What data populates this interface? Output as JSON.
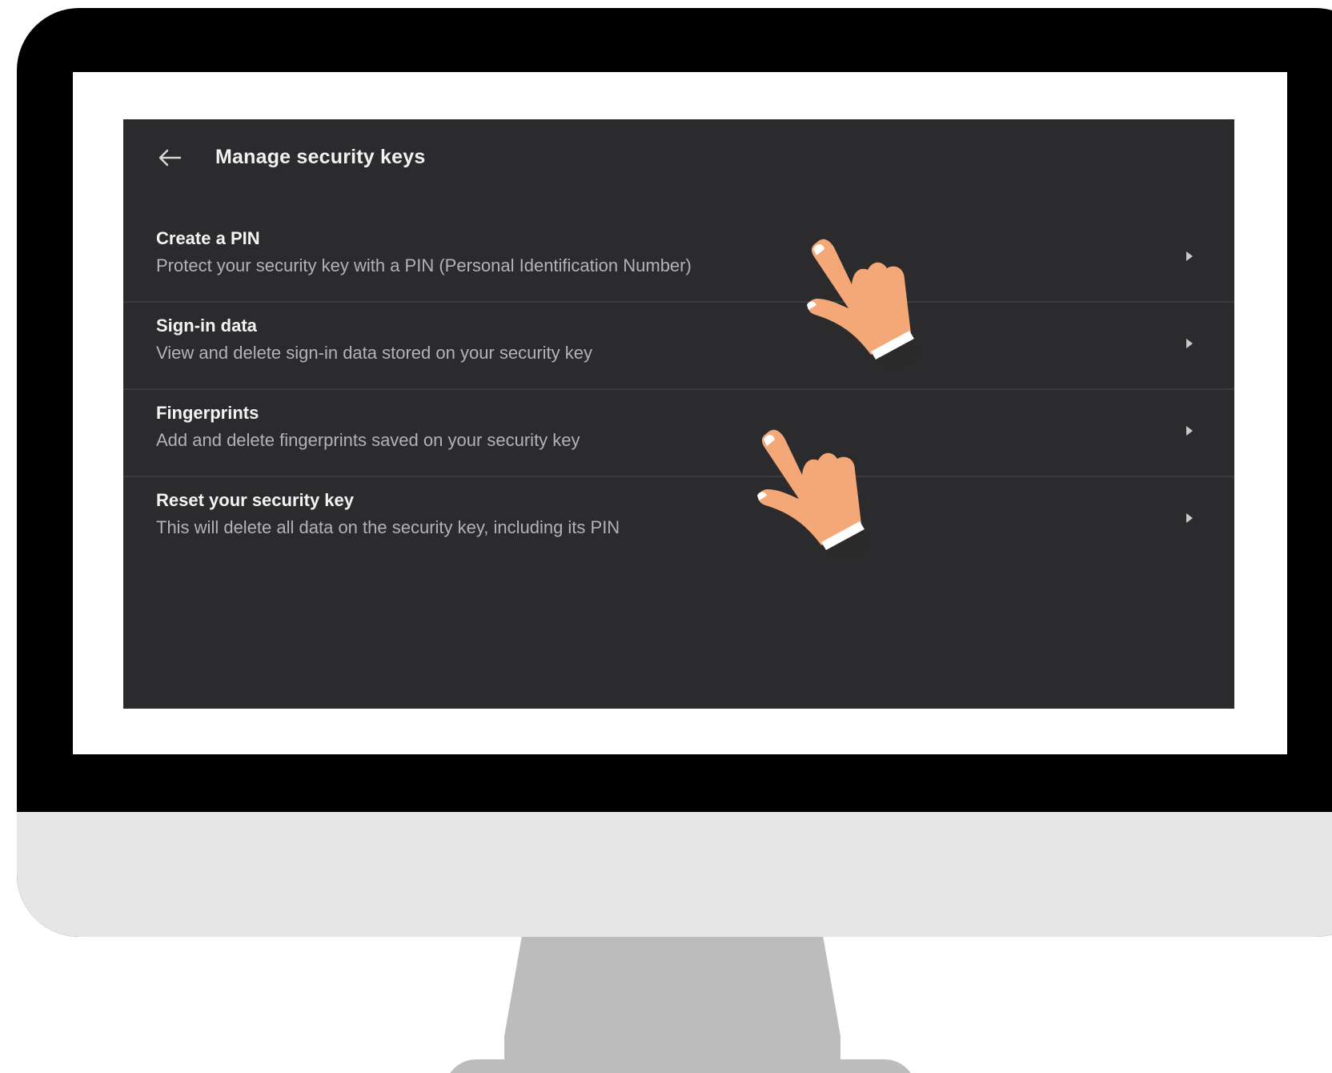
{
  "header": {
    "back_icon": "arrow-left-icon",
    "title": "Manage security keys"
  },
  "items": [
    {
      "title": "Create a PIN",
      "description": "Protect your security key with a PIN (Personal Identification Number)",
      "icon": "chevron-right-icon"
    },
    {
      "title": "Sign-in data",
      "description": "View and delete sign-in data stored on your security key",
      "icon": "chevron-right-icon"
    },
    {
      "title": "Fingerprints",
      "description": "Add and delete fingerprints saved on your security key",
      "icon": "chevron-right-icon"
    },
    {
      "title": "Reset your security key",
      "description": "This will delete all data on the security key, including its PIN",
      "icon": "chevron-right-icon"
    }
  ],
  "overlay": {
    "pointer_icon": "pointing-hand-icon",
    "skin_color": "#f4a878",
    "sleeve_color": "#2a2a2a"
  },
  "colors": {
    "panel_bg": "#2b2b2d",
    "monitor_frame": "#000000",
    "monitor_chin": "#e6e6e6",
    "stand": "#bcbcbc"
  }
}
